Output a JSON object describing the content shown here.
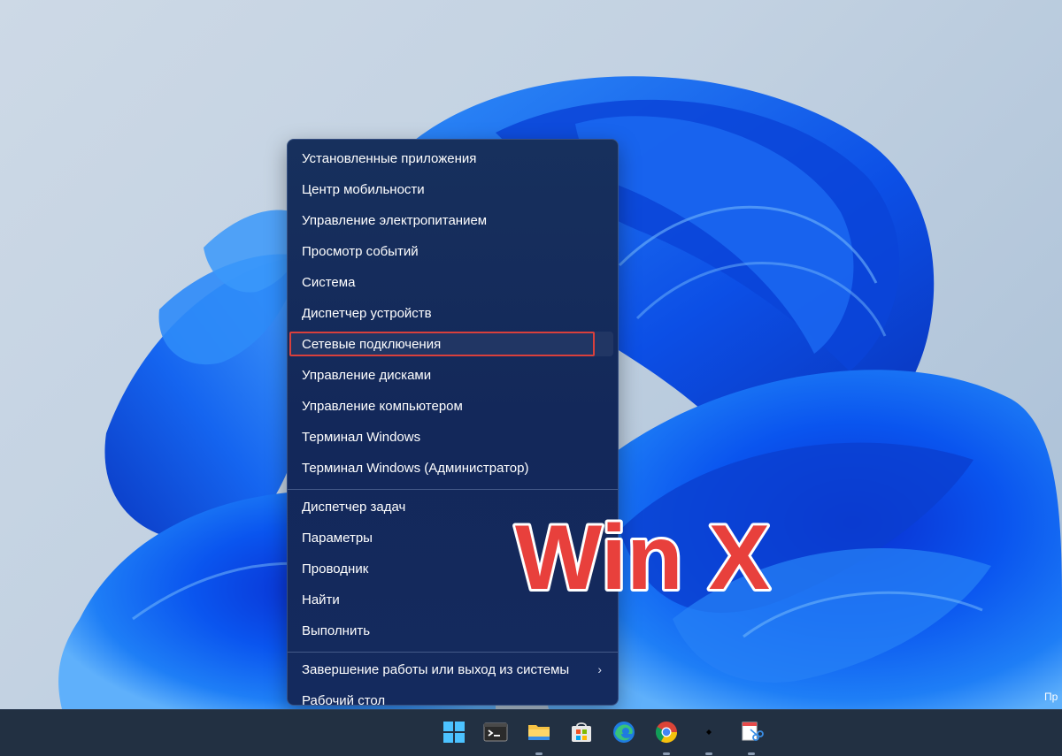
{
  "menu": {
    "groups": [
      {
        "items": [
          {
            "label": "Установленные приложения"
          },
          {
            "label": "Центр мобильности"
          },
          {
            "label": "Управление электропитанием"
          },
          {
            "label": "Просмотр событий"
          },
          {
            "label": "Система"
          },
          {
            "label": "Диспетчер устройств"
          },
          {
            "label": "Сетевые подключения",
            "highlighted": true
          },
          {
            "label": "Управление дисками"
          },
          {
            "label": "Управление компьютером"
          },
          {
            "label": "Терминал Windows"
          },
          {
            "label": "Терминал Windows (Администратор)"
          }
        ]
      },
      {
        "items": [
          {
            "label": "Диспетчер задач"
          },
          {
            "label": "Параметры"
          },
          {
            "label": "Проводник"
          },
          {
            "label": "Найти"
          },
          {
            "label": "Выполнить"
          }
        ]
      },
      {
        "items": [
          {
            "label": "Завершение работы или выход из системы",
            "submenu": true
          },
          {
            "label": "Рабочий стол"
          }
        ]
      }
    ],
    "highlight_color": "#d9403c"
  },
  "overlay": {
    "text": "Win X",
    "fill_color": "#e8403c",
    "outline_color": "#ffffff"
  },
  "corner_text": "Пр",
  "taskbar": {
    "icons": [
      {
        "name": "windows-start-icon"
      },
      {
        "name": "terminal-icon"
      },
      {
        "name": "file-explorer-icon"
      },
      {
        "name": "microsoft-store-icon"
      },
      {
        "name": "edge-icon"
      },
      {
        "name": "chrome-icon"
      },
      {
        "name": "small-black-app-icon"
      },
      {
        "name": "snipping-tool-icon"
      }
    ]
  }
}
